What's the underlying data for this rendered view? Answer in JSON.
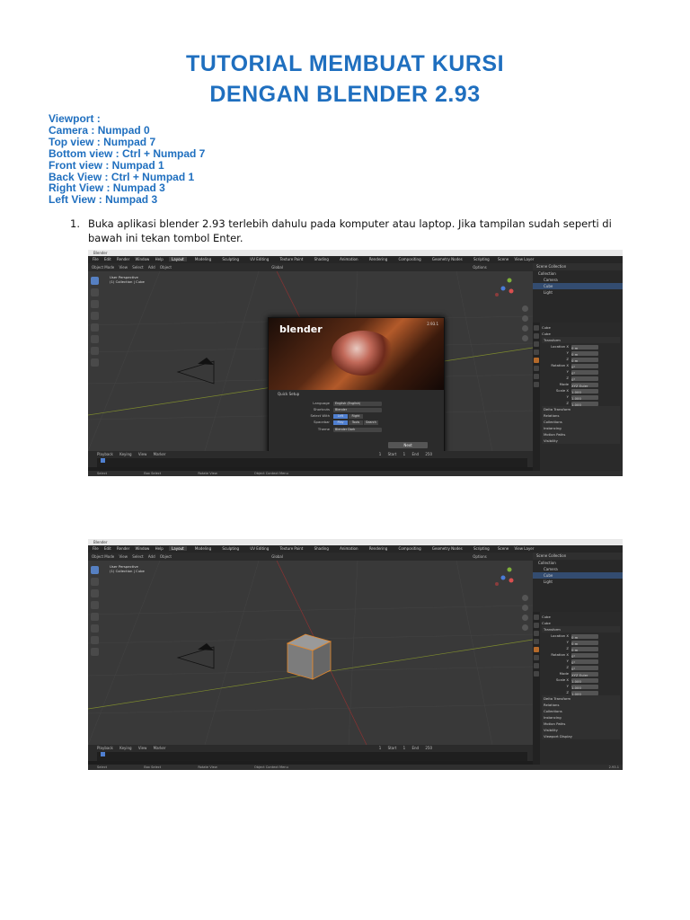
{
  "doc": {
    "title_line1": "TUTORIAL MEMBUAT KURSI",
    "title_line2": "DENGAN BLENDER 2.93",
    "viewport": [
      "Viewport :",
      "Camera : Numpad 0",
      "Top view : Numpad 7",
      "Bottom view : Ctrl + Numpad 7",
      "Front view : Numpad 1",
      "Back View : Ctrl + Numpad 1",
      "Right View : Numpad 3",
      "Left View : Numpad 3"
    ],
    "step_number": "1.",
    "step_text": "Buka aplikasi blender 2.93 terlebih dahulu pada komputer atau laptop. Jika tampilan sudah seperti di bawah ini tekan tombol Enter."
  },
  "blender": {
    "window_title": "Blender",
    "menus": [
      "File",
      "Edit",
      "Render",
      "Window",
      "Help"
    ],
    "workspaces": [
      "Layout",
      "Modeling",
      "Sculpting",
      "UV Editing",
      "Texture Paint",
      "Shading",
      "Animation",
      "Rendering",
      "Compositing",
      "Geometry Nodes",
      "Scripting"
    ],
    "scene": "Scene",
    "view_layer": "View Layer",
    "header_items": [
      "Object Mode",
      "View",
      "Select",
      "Add",
      "Object"
    ],
    "transform": "Global",
    "options": "Options",
    "vp_line1": "User Perspective",
    "vp_line2": "(1) Collection | Cube",
    "outliner": {
      "title": "Scene Collection",
      "items": [
        "Collection",
        "Camera",
        "Cube",
        "Light"
      ]
    },
    "props": {
      "object": "Cube",
      "data": "Cube",
      "transform": "Transform",
      "location": "Location X",
      "rotation": "Rotation X",
      "mode_label": "Mode",
      "mode_value": "XYZ Euler",
      "scale": "Scale X",
      "y": "Y",
      "z": "Z",
      "loc_val": "0 m",
      "rot_val": "0°",
      "scale_val": "1.000",
      "sections": [
        "Delta Transform",
        "Relations",
        "Collections",
        "Instancing",
        "Motion Paths",
        "Visibility",
        "Viewport Display"
      ]
    },
    "timeline": [
      "Playback",
      "Keying",
      "View",
      "Marker"
    ],
    "frame": {
      "current": "1",
      "start_label": "Start",
      "start": "1",
      "end_label": "End",
      "end": "250"
    },
    "status": [
      "Select",
      "Box Select",
      "Rotate View",
      "Object Context Menu"
    ],
    "version_corner": "2.93.1",
    "splash": {
      "logo": "blender",
      "version": "2.93.1",
      "quick_setup": "Quick Setup",
      "language_label": "Language",
      "language": "English (English)",
      "shortcuts_label": "Shortcuts",
      "shortcuts": "Blender",
      "select_label": "Select With",
      "select_left": "Left",
      "select_right": "Right",
      "spacebar_label": "Spacebar",
      "space_play": "Play",
      "space_tools": "Tools",
      "space_search": "Search",
      "theme_label": "Theme",
      "theme": "Blender Dark",
      "next": "Next"
    }
  }
}
